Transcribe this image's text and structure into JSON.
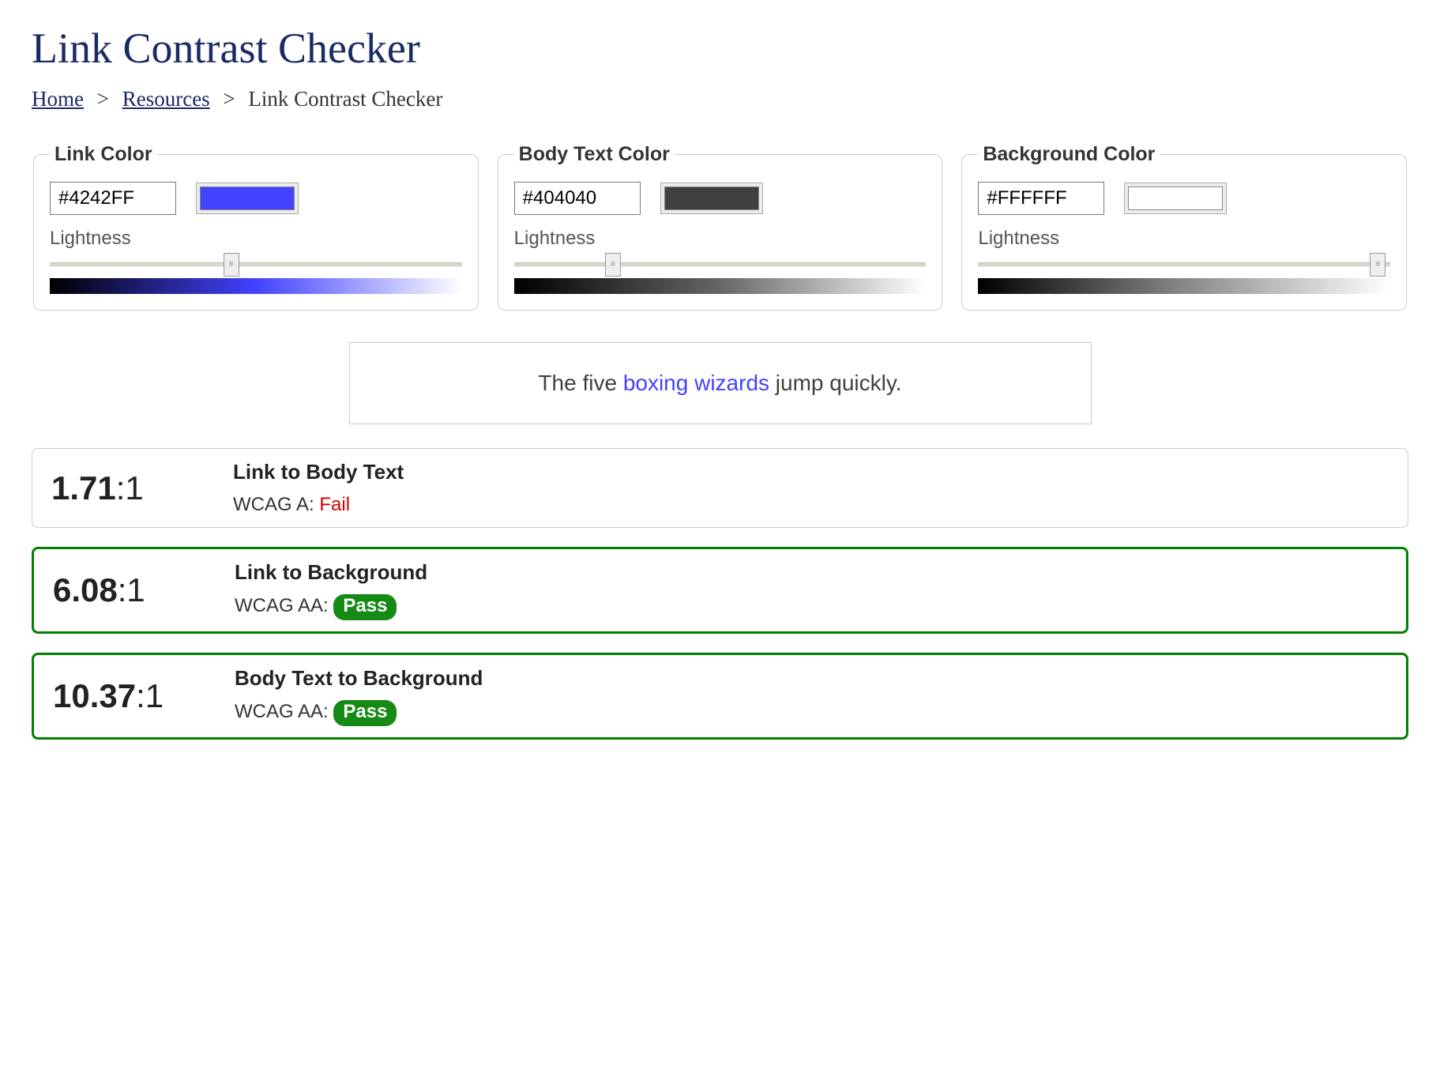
{
  "page": {
    "title": "Link Contrast Checker"
  },
  "breadcrumb": {
    "home": "Home",
    "resources": "Resources",
    "current": "Link Contrast Checker",
    "sep": ">"
  },
  "pickers": {
    "lightness_label": "Lightness",
    "link": {
      "legend": "Link Color",
      "hex": "#4242FF",
      "swatch_color": "#4242FF",
      "slider_pct": 44,
      "gradient_from": "#000000",
      "gradient_mid": "#4242FF",
      "gradient_to": "#ffffff"
    },
    "body": {
      "legend": "Body Text Color",
      "hex": "#404040",
      "swatch_color": "#404040",
      "slider_pct": 24,
      "gradient_from": "#000000",
      "gradient_mid": "#666666",
      "gradient_to": "#ffffff"
    },
    "bg": {
      "legend": "Background Color",
      "hex": "#FFFFFF",
      "swatch_color": "#FFFFFF",
      "slider_pct": 97,
      "gradient_from": "#000000",
      "gradient_mid": "#888888",
      "gradient_to": "#ffffff"
    }
  },
  "preview": {
    "before": "The five ",
    "link": "boxing wizards",
    "after": " jump quickly.",
    "body_color": "#404040",
    "link_color": "#4242FF",
    "bg_color": "#FFFFFF"
  },
  "results": [
    {
      "ratio_value": "1.71",
      "ratio_suffix": ":1",
      "title": "Link to Body Text",
      "wcag_label": "WCAG A: ",
      "status": "Fail",
      "pass": false
    },
    {
      "ratio_value": "6.08",
      "ratio_suffix": ":1",
      "title": "Link to Background",
      "wcag_label": "WCAG AA: ",
      "status": "Pass",
      "pass": true
    },
    {
      "ratio_value": "10.37",
      "ratio_suffix": ":1",
      "title": "Body Text to Background",
      "wcag_label": "WCAG AA: ",
      "status": "Pass",
      "pass": true
    }
  ]
}
